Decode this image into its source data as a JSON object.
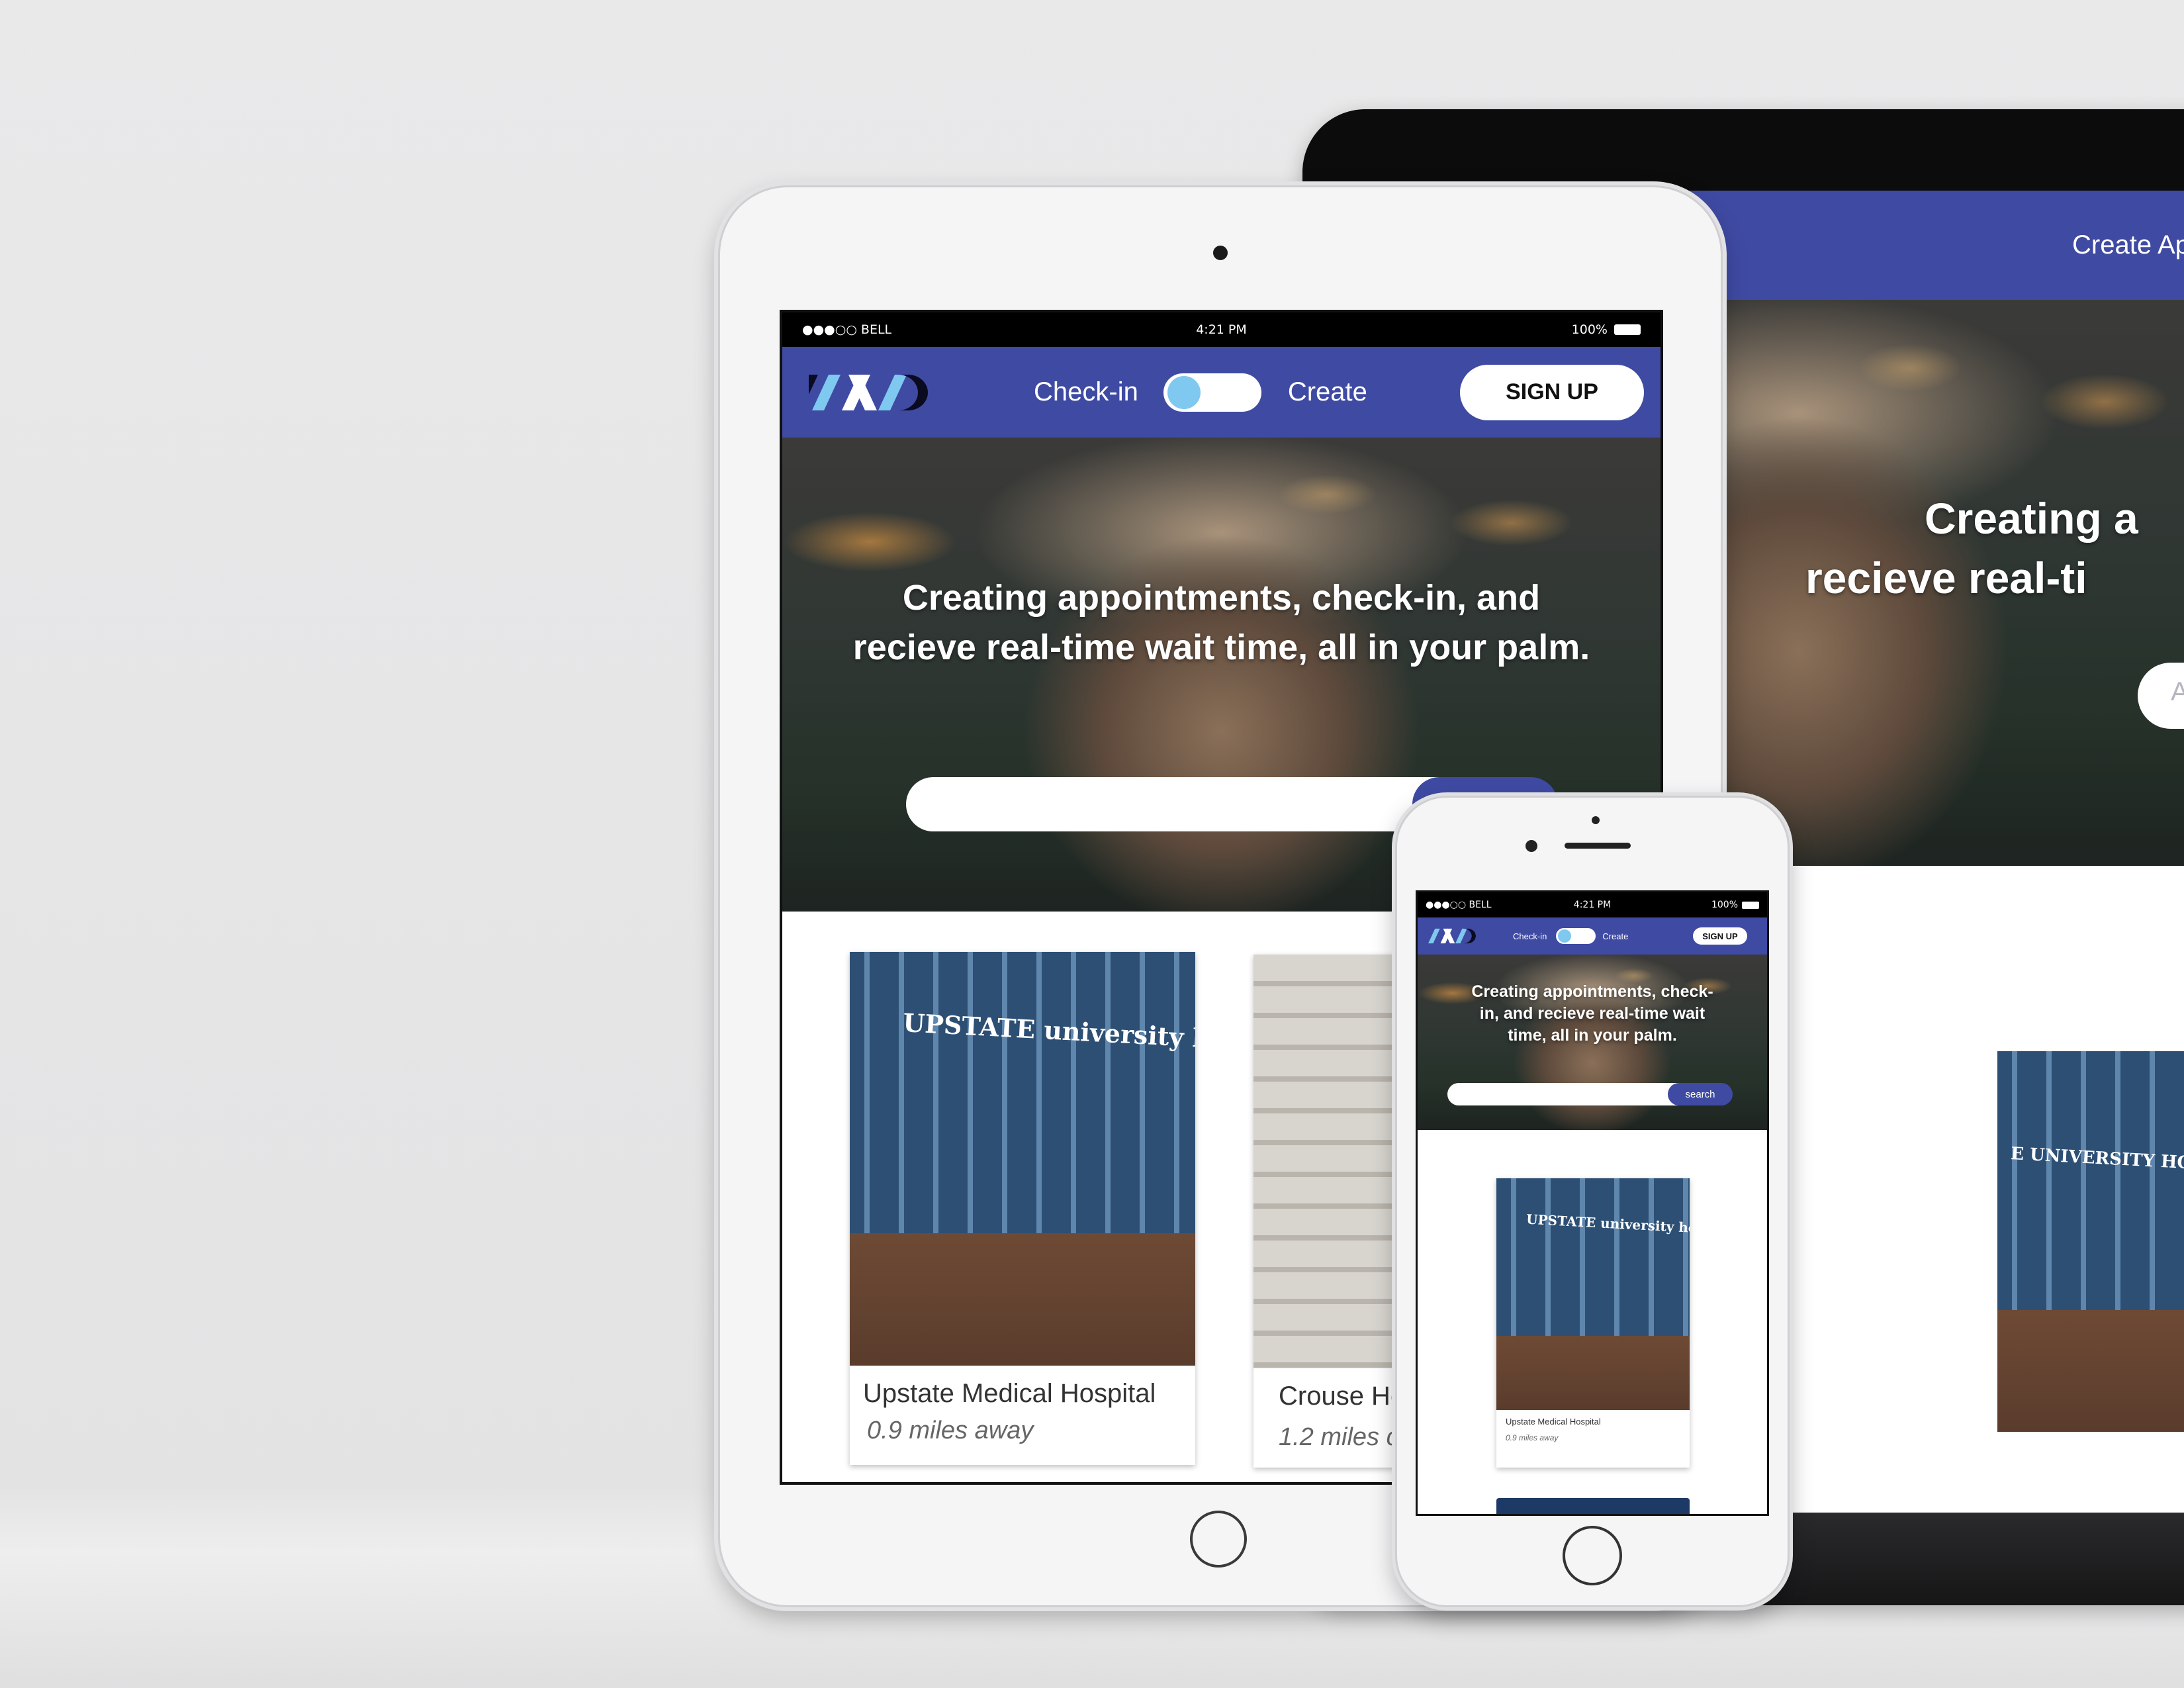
{
  "status_bar": {
    "carrier": "●●●○○ BELL",
    "time": "4:21 PM",
    "battery": "100%"
  },
  "nav": {
    "toggle_left": "Check-in",
    "toggle_right": "Create",
    "signup": "SIGN UP",
    "create_link": "Create Ap"
  },
  "hero": {
    "headline_line1": "Creating appointments, check-in, and",
    "headline_line2": "recieve real-time wait time, all in your palm.",
    "headline_phone": "Creating appointments, check-in, and recieve real-time wait time, all in your palm.",
    "headline_laptop_line1": "Creating a",
    "headline_laptop_line2": "recieve real-ti",
    "search_placeholder": "Address, Hospital Nam",
    "search_button": "search"
  },
  "cards": [
    {
      "name": "Upstate Medical Hospital",
      "distance": "0.9 miles away",
      "sign": "UPSTATE university hospital"
    },
    {
      "name": "Crouse Hc",
      "distance": "1.2 miles c"
    }
  ],
  "laptop_card_sign": "E UNIVERSITY HOSPITAL",
  "colors": {
    "brand": "#3f4aa3",
    "toggle_knob": "#7fc8f0",
    "background": "#e6e6e7"
  }
}
